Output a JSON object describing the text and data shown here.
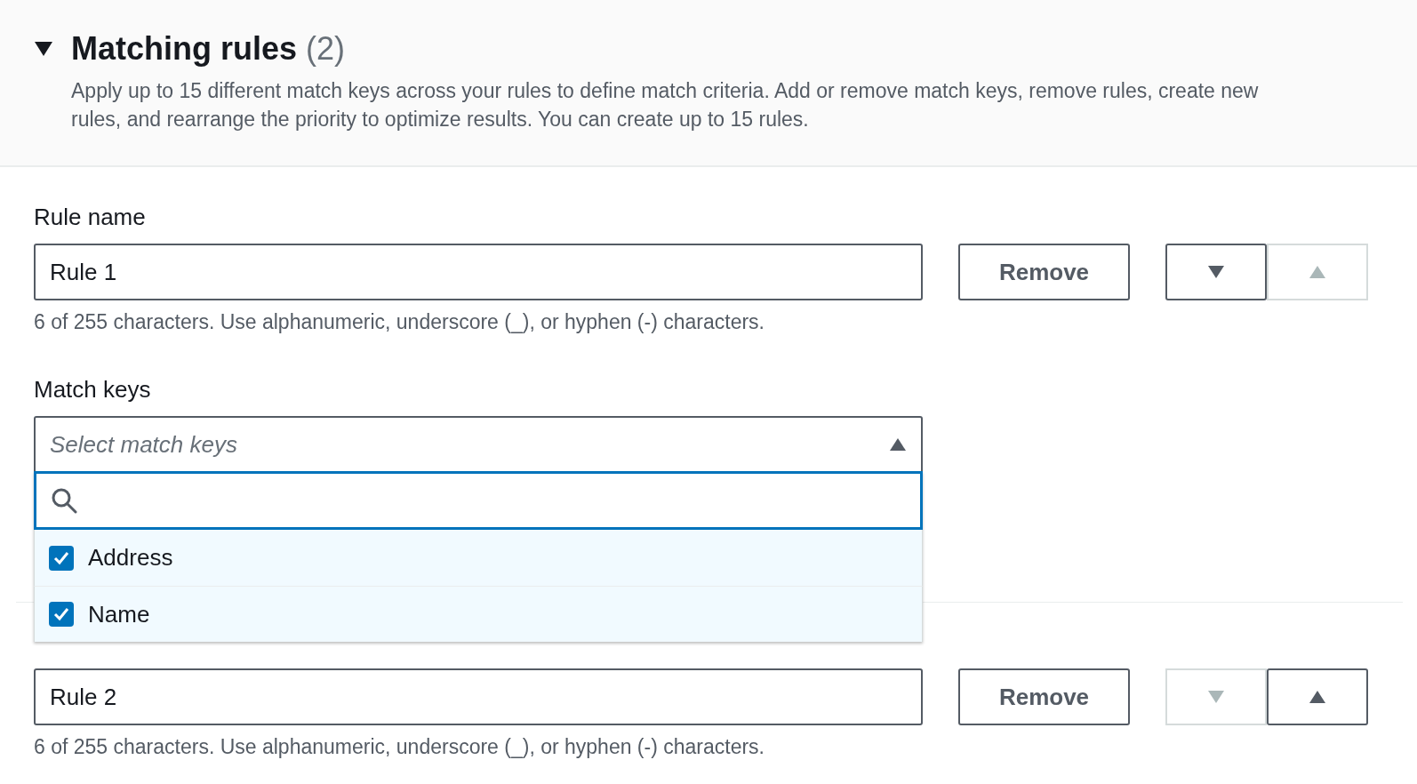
{
  "section": {
    "title": "Matching rules",
    "count": "(2)",
    "expanded": true,
    "description": "Apply up to 15 different match keys across your rules to define match criteria. Add or remove match keys, remove rules, create new rules, and rearrange the priority to optimize results. You can create up to 15 rules."
  },
  "rules": [
    {
      "name_label": "Rule name",
      "name_value": "Rule 1",
      "helper": "6 of 255 characters. Use alphanumeric, underscore (_), or hyphen (-) characters.",
      "remove": "Remove",
      "move_down_disabled": false,
      "move_up_disabled": true,
      "match_keys": {
        "label": "Match keys",
        "placeholder": "Select match keys",
        "expanded": true,
        "options": [
          {
            "label": "Address",
            "checked": true
          },
          {
            "label": "Name",
            "checked": true
          }
        ]
      }
    },
    {
      "name_value": "Rule 2",
      "helper": "6 of 255 characters. Use alphanumeric, underscore (_), or hyphen (-) characters.",
      "remove": "Remove",
      "move_down_disabled": true,
      "move_up_disabled": false
    }
  ]
}
